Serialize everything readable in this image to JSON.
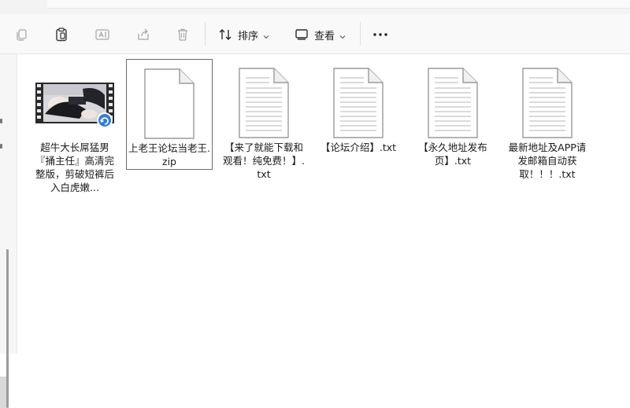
{
  "toolbar": {
    "sort_label": "排序",
    "view_label": "查看"
  },
  "files": [
    {
      "name": "超牛大长屌猛男『捅主任』高清完整版，剪破短裤后入白虎嫩...",
      "type": "video",
      "icon": "video-thumbnail-icon"
    },
    {
      "name": "上老王论坛当老王.zip",
      "type": "zip",
      "icon": "zip-file-icon",
      "selected": true
    },
    {
      "name": "【来了就能下载和观看！纯免费！】.txt",
      "type": "txt",
      "icon": "text-file-icon"
    },
    {
      "name": "【论坛介绍】.txt",
      "type": "txt",
      "icon": "text-file-icon"
    },
    {
      "name": "【永久地址发布页】.txt",
      "type": "txt",
      "icon": "text-file-icon"
    },
    {
      "name": "最新地址及APP请发邮箱自动获取！！！.txt",
      "type": "txt",
      "icon": "text-file-icon"
    }
  ],
  "colors": {
    "toolbar_bg": "#f9f9f9",
    "sync_badge": "#2f7de1",
    "selection_border": "#6b6b6b"
  }
}
